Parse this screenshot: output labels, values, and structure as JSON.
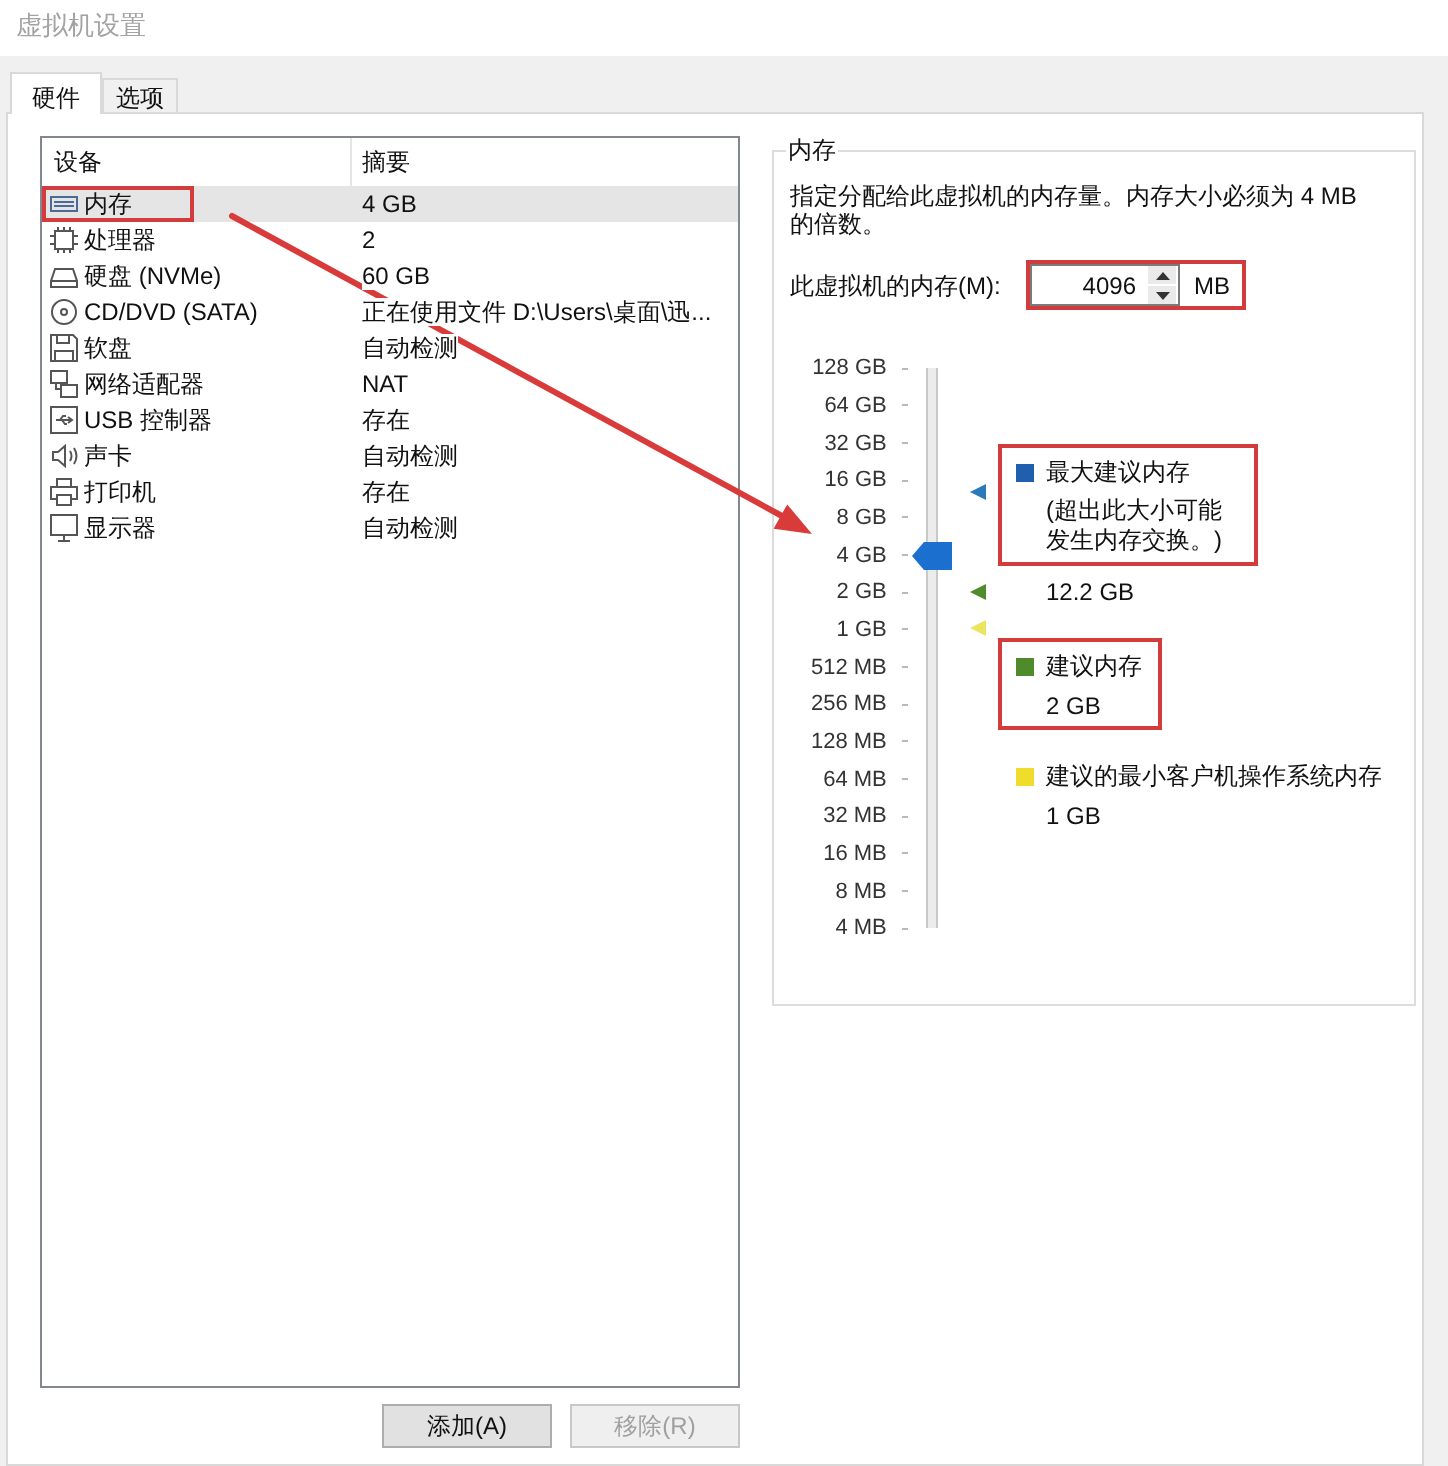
{
  "window": {
    "title": "虚拟机设置"
  },
  "tabs": [
    {
      "label": "硬件",
      "selected": true
    },
    {
      "label": "选项",
      "selected": false
    }
  ],
  "device_list": {
    "columns": [
      "设备",
      "摘要"
    ],
    "rows": [
      {
        "kind": "memory",
        "device": "内存",
        "summary": "4 GB",
        "selected": true,
        "highlighted": true
      },
      {
        "kind": "processor",
        "device": "处理器",
        "summary": "2",
        "selected": false,
        "highlighted": false
      },
      {
        "kind": "disk",
        "device": "硬盘 (NVMe)",
        "summary": "60 GB",
        "selected": false,
        "highlighted": false
      },
      {
        "kind": "cdrom",
        "device": "CD/DVD (SATA)",
        "summary": "正在使用文件 D:\\Users\\桌面\\迅...",
        "selected": false,
        "highlighted": false
      },
      {
        "kind": "floppy",
        "device": "软盘",
        "summary": "自动检测",
        "selected": false,
        "highlighted": false
      },
      {
        "kind": "network",
        "device": "网络适配器",
        "summary": "NAT",
        "selected": false,
        "highlighted": false
      },
      {
        "kind": "usb",
        "device": "USB 控制器",
        "summary": "存在",
        "selected": false,
        "highlighted": false
      },
      {
        "kind": "sound",
        "device": "声卡",
        "summary": "自动检测",
        "selected": false,
        "highlighted": false
      },
      {
        "kind": "printer",
        "device": "打印机",
        "summary": "存在",
        "selected": false,
        "highlighted": false
      },
      {
        "kind": "display",
        "device": "显示器",
        "summary": "自动检测",
        "selected": false,
        "highlighted": false
      }
    ]
  },
  "buttons": [
    {
      "label": "添加(A)",
      "disabled": false
    },
    {
      "label": "移除(R)",
      "disabled": true
    }
  ],
  "memory": {
    "title": "内存",
    "description": "指定分配给此虚拟机的内存量。内存大小必须为 4 MB 的倍数。",
    "field_label": "此虚拟机的内存(M):",
    "value": "4096",
    "unit": "MB",
    "highlighted": true,
    "slider": {
      "level": 0.667,
      "ticks": [
        "128 GB",
        "64 GB",
        "32 GB",
        "16 GB",
        "8 GB",
        "4 GB",
        "2 GB",
        "1 GB",
        "512 MB",
        "256 MB",
        "128 MB",
        "64 MB",
        "32 MB",
        "16 MB",
        "8 MB",
        "4 MB"
      ],
      "markers": [
        {
          "color": "#2b79b8",
          "level": 0.78
        },
        {
          "color": "#4f8a2b",
          "level": 0.6
        },
        {
          "color": "#ece35e",
          "level": 0.536
        }
      ]
    },
    "legend": [
      {
        "color": "#1f5fae",
        "label": "最大建议内存",
        "note": "(超出此大小可能发生内存交换。)",
        "value": "12.2 GB",
        "highlighted": true
      },
      {
        "color": "#4f8a2b",
        "label": "建议内存",
        "value": "2 GB",
        "highlighted": true
      },
      {
        "color": "#f0dc2c",
        "label": "建议的最小客户机操作系统内存",
        "value": "1 GB",
        "highlighted": false
      }
    ]
  }
}
